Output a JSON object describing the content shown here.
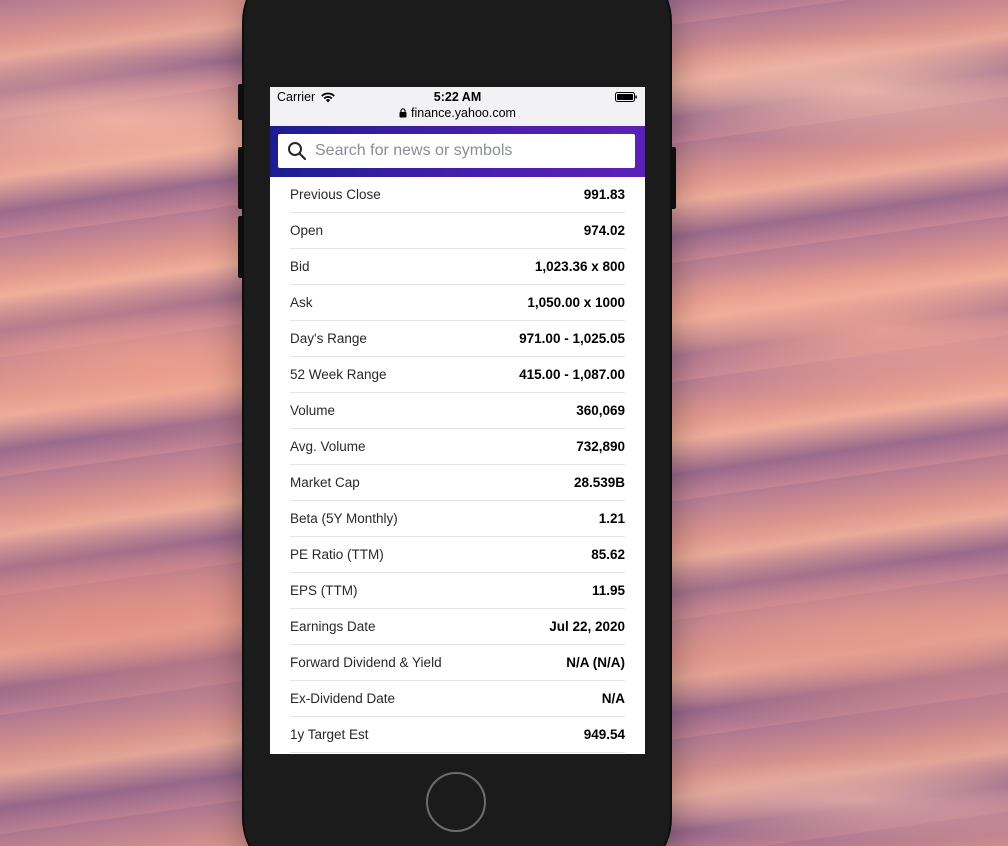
{
  "status_bar": {
    "carrier": "Carrier",
    "time": "5:22 AM",
    "url": "finance.yahoo.com",
    "icons": [
      "wifi-icon",
      "battery-icon",
      "lock-icon"
    ]
  },
  "search": {
    "placeholder": "Search for news or symbols",
    "value": "",
    "icon": "search-icon"
  },
  "stats": [
    {
      "label": "Previous Close",
      "value": "991.83"
    },
    {
      "label": "Open",
      "value": "974.02"
    },
    {
      "label": "Bid",
      "value": "1,023.36 x 800"
    },
    {
      "label": "Ask",
      "value": "1,050.00 x 1000"
    },
    {
      "label": "Day's Range",
      "value": "971.00 - 1,025.05"
    },
    {
      "label": "52 Week Range",
      "value": "415.00 - 1,087.00"
    },
    {
      "label": "Volume",
      "value": "360,069"
    },
    {
      "label": "Avg. Volume",
      "value": "732,890"
    },
    {
      "label": "Market Cap",
      "value": "28.539B"
    },
    {
      "label": "Beta (5Y Monthly)",
      "value": "1.21"
    },
    {
      "label": "PE Ratio (TTM)",
      "value": "85.62"
    },
    {
      "label": "EPS (TTM)",
      "value": "11.95"
    },
    {
      "label": "Earnings Date",
      "value": "Jul 22, 2020"
    },
    {
      "label": "Forward Dividend & Yield",
      "value": "N/A (N/A)"
    },
    {
      "label": "Ex-Dividend Date",
      "value": "N/A"
    },
    {
      "label": "1y Target Est",
      "value": "949.54"
    }
  ],
  "colors": {
    "header_gradient_start": "#1a1d8f",
    "header_gradient_end": "#5b21b6",
    "phone_body": "#1b1b1c"
  }
}
